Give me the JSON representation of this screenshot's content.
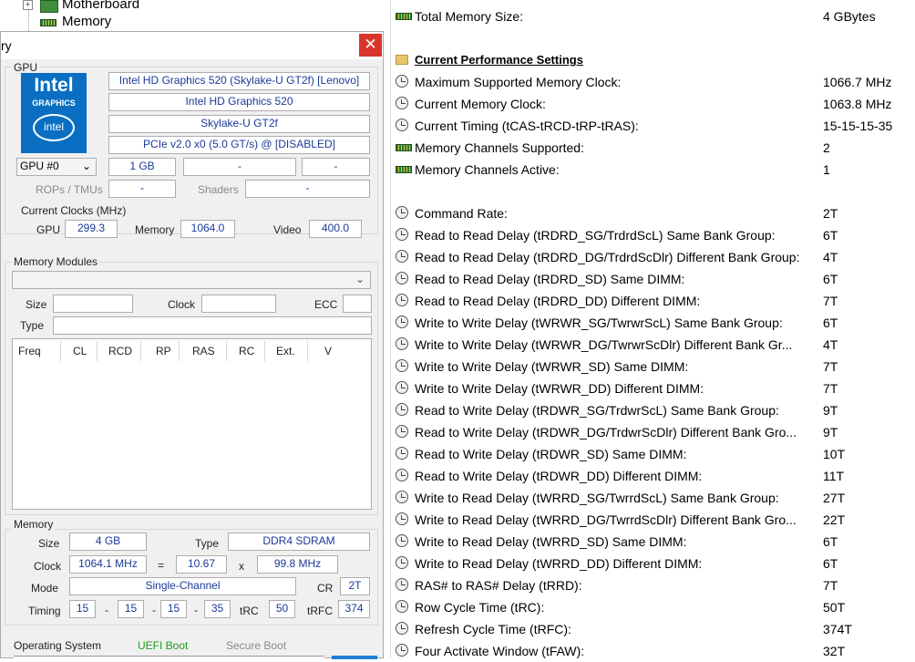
{
  "tree": {
    "motherboard": "Motherboard",
    "memory": "Memory"
  },
  "window": {
    "title_fragment": "ry",
    "close": "✕"
  },
  "gpu": {
    "group_label": "GPU",
    "logo_line1": "Intel",
    "logo_line2": "GRAPHICS",
    "logo_line3": "intel",
    "name_full": "Intel HD Graphics 520 (Skylake-U GT2f) [Lenovo]",
    "name": "Intel HD Graphics 520",
    "codename": "Skylake-U GT2f",
    "bus": "PCIe v2.0 x0 (5.0 GT/s) @ [DISABLED]",
    "selector": "GPU #0",
    "memory_size": "1 GB",
    "field2": "-",
    "field3": "-",
    "rops_label": "ROPs / TMUs",
    "rops_value": "-",
    "shaders_label": "Shaders",
    "shaders_value": "-",
    "clocks_label": "Current Clocks (MHz)",
    "gpu_label": "GPU",
    "gpu_clock": "299.3",
    "mem_label": "Memory",
    "mem_clock": "1064.0",
    "video_label": "Video",
    "video_clock": "400.0"
  },
  "modules": {
    "group_label": "Memory Modules",
    "size_label": "Size",
    "clock_label": "Clock",
    "ecc_label": "ECC",
    "type_label": "Type",
    "columns": [
      "Freq",
      "CL",
      "RCD",
      "RP",
      "RAS",
      "RC",
      "Ext.",
      "V"
    ]
  },
  "memory": {
    "group_label": "Memory",
    "size_label": "Size",
    "size": "4 GB",
    "type_label": "Type",
    "type": "DDR4 SDRAM",
    "clock_label": "Clock",
    "clock": "1064.1 MHz",
    "eq": "=",
    "mult": "10.67",
    "x": "x",
    "bclk": "99.8 MHz",
    "mode_label": "Mode",
    "mode": "Single-Channel",
    "cr_label": "CR",
    "cr": "2T",
    "timing_label": "Timing",
    "t1": "15",
    "t2": "15",
    "t3": "15",
    "t4": "35",
    "dash": "-",
    "trc_label": "tRC",
    "trc": "50",
    "trfc_label": "tRFC",
    "trfc": "374"
  },
  "os": {
    "label": "Operating System",
    "uefi": "UEFI Boot",
    "secure": "Secure Boot",
    "uefi_color": "#1e9b1e"
  },
  "props": {
    "rows": [
      {
        "icon": "ram",
        "label": "Total Memory Size:",
        "value": "4 GBytes"
      },
      {
        "icon": "none",
        "label": "",
        "value": ""
      },
      {
        "icon": "folder",
        "label": "Current Performance Settings",
        "value": "",
        "section": true
      },
      {
        "icon": "clock",
        "label": "Maximum Supported Memory Clock:",
        "value": "1066.7 MHz"
      },
      {
        "icon": "clock",
        "label": "Current Memory Clock:",
        "value": "1063.8 MHz"
      },
      {
        "icon": "clock",
        "label": "Current Timing (tCAS-tRCD-tRP-tRAS):",
        "value": "15-15-15-35"
      },
      {
        "icon": "ram",
        "label": "Memory Channels Supported:",
        "value": "2"
      },
      {
        "icon": "ram",
        "label": "Memory Channels Active:",
        "value": "1"
      },
      {
        "icon": "none",
        "label": "",
        "value": ""
      },
      {
        "icon": "clock",
        "label": "Command Rate:",
        "value": "2T"
      },
      {
        "icon": "clock",
        "label": "Read to Read Delay (tRDRD_SG/TrdrdScL) Same Bank Group:",
        "value": "6T"
      },
      {
        "icon": "clock",
        "label": "Read to Read Delay (tRDRD_DG/TrdrdScDlr) Different Bank Group:",
        "value": "4T"
      },
      {
        "icon": "clock",
        "label": "Read to Read Delay (tRDRD_SD) Same DIMM:",
        "value": "6T"
      },
      {
        "icon": "clock",
        "label": "Read to Read Delay (tRDRD_DD) Different DIMM:",
        "value": "7T"
      },
      {
        "icon": "clock",
        "label": "Write to Write Delay (tWRWR_SG/TwrwrScL) Same Bank Group:",
        "value": "6T"
      },
      {
        "icon": "clock",
        "label": "Write to Write Delay (tWRWR_DG/TwrwrScDlr) Different Bank Gr...",
        "value": "4T"
      },
      {
        "icon": "clock",
        "label": "Write to Write Delay (tWRWR_SD) Same DIMM:",
        "value": "7T"
      },
      {
        "icon": "clock",
        "label": "Write to Write Delay (tWRWR_DD) Different DIMM:",
        "value": "7T"
      },
      {
        "icon": "clock",
        "label": "Read to Write Delay (tRDWR_SG/TrdwrScL) Same Bank Group:",
        "value": "9T"
      },
      {
        "icon": "clock",
        "label": "Read to Write Delay (tRDWR_DG/TrdwrScDlr) Different Bank Gro...",
        "value": "9T"
      },
      {
        "icon": "clock",
        "label": "Read to Write Delay (tRDWR_SD) Same DIMM:",
        "value": "10T"
      },
      {
        "icon": "clock",
        "label": "Read to Write Delay (tRDWR_DD) Different DIMM:",
        "value": "11T"
      },
      {
        "icon": "clock",
        "label": "Write to Read Delay (tWRRD_SG/TwrrdScL) Same Bank Group:",
        "value": "27T"
      },
      {
        "icon": "clock",
        "label": "Write to Read Delay (tWRRD_DG/TwrrdScDlr) Different Bank Gro...",
        "value": "22T"
      },
      {
        "icon": "clock",
        "label": "Write to Read Delay (tWRRD_SD) Same DIMM:",
        "value": "6T"
      },
      {
        "icon": "clock",
        "label": "Write to Read Delay (tWRRD_DD) Different DIMM:",
        "value": "6T"
      },
      {
        "icon": "clock",
        "label": "RAS# to RAS# Delay (tRRD):",
        "value": "7T"
      },
      {
        "icon": "clock",
        "label": "Row Cycle Time (tRC):",
        "value": "50T"
      },
      {
        "icon": "clock",
        "label": "Refresh Cycle Time (tRFC):",
        "value": "374T"
      },
      {
        "icon": "clock",
        "label": "Four Activate Window (tFAW):",
        "value": "32T"
      }
    ]
  }
}
